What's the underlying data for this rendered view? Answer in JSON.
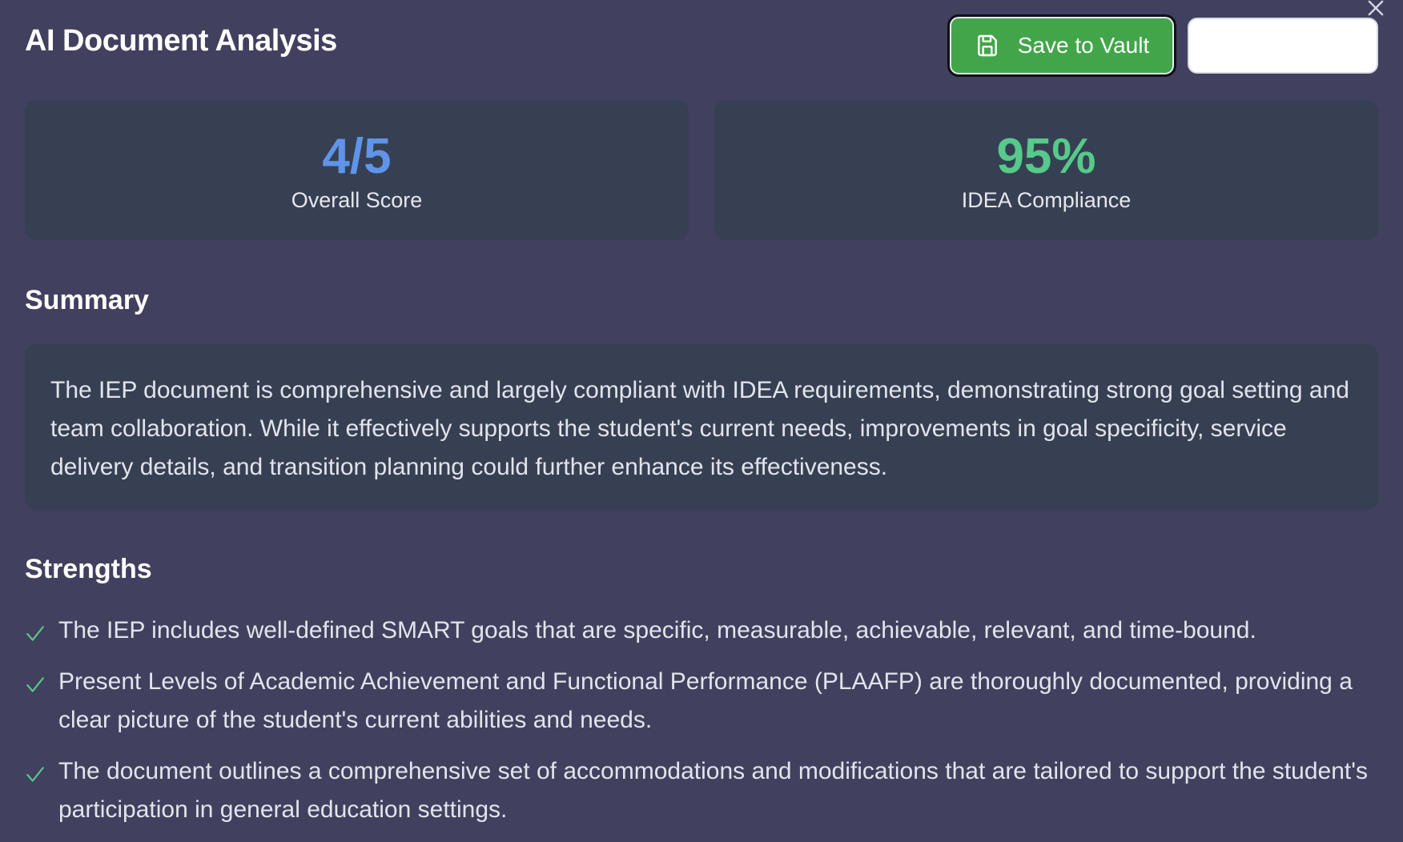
{
  "header": {
    "title": "AI Document Analysis",
    "save_button_label": "Save to Vault",
    "secondary_button_label": ""
  },
  "stats": [
    {
      "value": "4/5",
      "label": "Overall Score",
      "color": "#5f94e8"
    },
    {
      "value": "95%",
      "label": "IDEA Compliance",
      "color": "#57c98a"
    }
  ],
  "summary": {
    "heading": "Summary",
    "text": "The IEP document is comprehensive and largely compliant with IDEA requirements, demonstrating strong goal setting and team collaboration. While it effectively supports the student's current needs, improvements in goal specificity, service delivery details, and transition planning could further enhance its effectiveness."
  },
  "strengths": {
    "heading": "Strengths",
    "items": [
      "The IEP includes well-defined SMART goals that are specific, measurable, achievable, relevant, and time-bound.",
      "Present Levels of Academic Achievement and Functional Performance (PLAAFP) are thoroughly documented, providing a clear picture of the student's current abilities and needs.",
      "The document outlines a comprehensive set of accommodations and modifications that are tailored to support the student's participation in general education settings."
    ]
  },
  "colors": {
    "background": "#41405e",
    "card": "#374053",
    "save_button": "#43a54a",
    "check": "#57c98a"
  },
  "icons": {
    "close": "close-icon",
    "save": "floppy-disk-icon",
    "check": "checkmark-icon"
  }
}
